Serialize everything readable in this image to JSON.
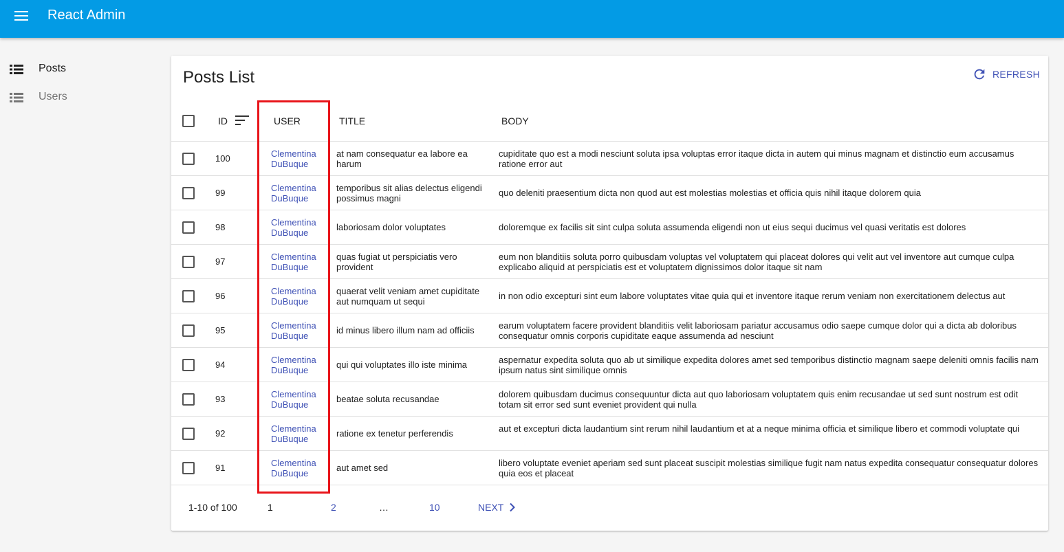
{
  "appbar": {
    "title": "React Admin"
  },
  "sidebar": {
    "items": [
      {
        "label": "Posts"
      },
      {
        "label": "Users"
      }
    ]
  },
  "list": {
    "title": "Posts List",
    "refresh_label": "REFRESH",
    "columns": {
      "id": "ID",
      "user": "USER",
      "title": "TITLE",
      "body": "BODY"
    },
    "rows": [
      {
        "id": "100",
        "user": "Clementina DuBuque",
        "title": "at nam consequatur ea labore ea harum",
        "body": "cupiditate quo est a modi nesciunt soluta ipsa voluptas error itaque dicta in autem qui minus magnam et distinctio eum accusamus ratione error aut"
      },
      {
        "id": "99",
        "user": "Clementina DuBuque",
        "title": "temporibus sit alias delectus eligendi possimus magni",
        "body": "quo deleniti praesentium dicta non quod aut est molestias molestias et officia quis nihil itaque dolorem quia"
      },
      {
        "id": "98",
        "user": "Clementina DuBuque",
        "title": "laboriosam dolor voluptates",
        "body": "doloremque ex facilis sit sint culpa soluta assumenda eligendi non ut eius sequi ducimus vel quasi veritatis est dolores"
      },
      {
        "id": "97",
        "user": "Clementina DuBuque",
        "title": "quas fugiat ut perspiciatis vero provident",
        "body": "eum non blanditiis soluta porro quibusdam voluptas vel voluptatem qui placeat dolores qui velit aut vel inventore aut cumque culpa explicabo aliquid at perspiciatis est et voluptatem dignissimos dolor itaque sit nam"
      },
      {
        "id": "96",
        "user": "Clementina DuBuque",
        "title": "quaerat velit veniam amet cupiditate aut numquam ut sequi",
        "body": "in non odio excepturi sint eum labore voluptates vitae quia qui et inventore itaque rerum veniam non exercitationem delectus aut"
      },
      {
        "id": "95",
        "user": "Clementina DuBuque",
        "title": "id minus libero illum nam ad officiis",
        "body": "earum voluptatem facere provident blanditiis velit laboriosam pariatur accusamus odio saepe cumque dolor qui a dicta ab doloribus consequatur omnis corporis cupiditate eaque assumenda ad nesciunt"
      },
      {
        "id": "94",
        "user": "Clementina DuBuque",
        "title": "qui qui voluptates illo iste minima",
        "body": "aspernatur expedita soluta quo ab ut similique expedita dolores amet sed temporibus distinctio magnam saepe deleniti omnis facilis nam ipsum natus sint similique omnis"
      },
      {
        "id": "93",
        "user": "Clementina DuBuque",
        "title": "beatae soluta recusandae",
        "body": "dolorem quibusdam ducimus consequuntur dicta aut quo laboriosam voluptatem quis enim recusandae ut sed sunt nostrum est odit totam sit error sed sunt eveniet provident qui nulla"
      },
      {
        "id": "92",
        "user": "Clementina DuBuque",
        "title": "ratione ex tenetur perferendis",
        "body": "aut et excepturi dicta laudantium sint rerum nihil laudantium et at a neque minima officia et similique libero et commodi voluptate qui"
      },
      {
        "id": "91",
        "user": "Clementina DuBuque",
        "title": "aut amet sed",
        "body": "libero voluptate eveniet aperiam sed sunt placeat suscipit molestias similique fugit nam natus expedita consequatur consequatur dolores quia eos et placeat"
      }
    ],
    "pagination": {
      "range": "1-10 of 100",
      "current": "1",
      "page2": "2",
      "ellipsis": "…",
      "last": "10",
      "next_label": "NEXT"
    }
  },
  "colors": {
    "appbar": "#039be5",
    "link": "#3f51b5",
    "highlight": "#e8141a"
  }
}
